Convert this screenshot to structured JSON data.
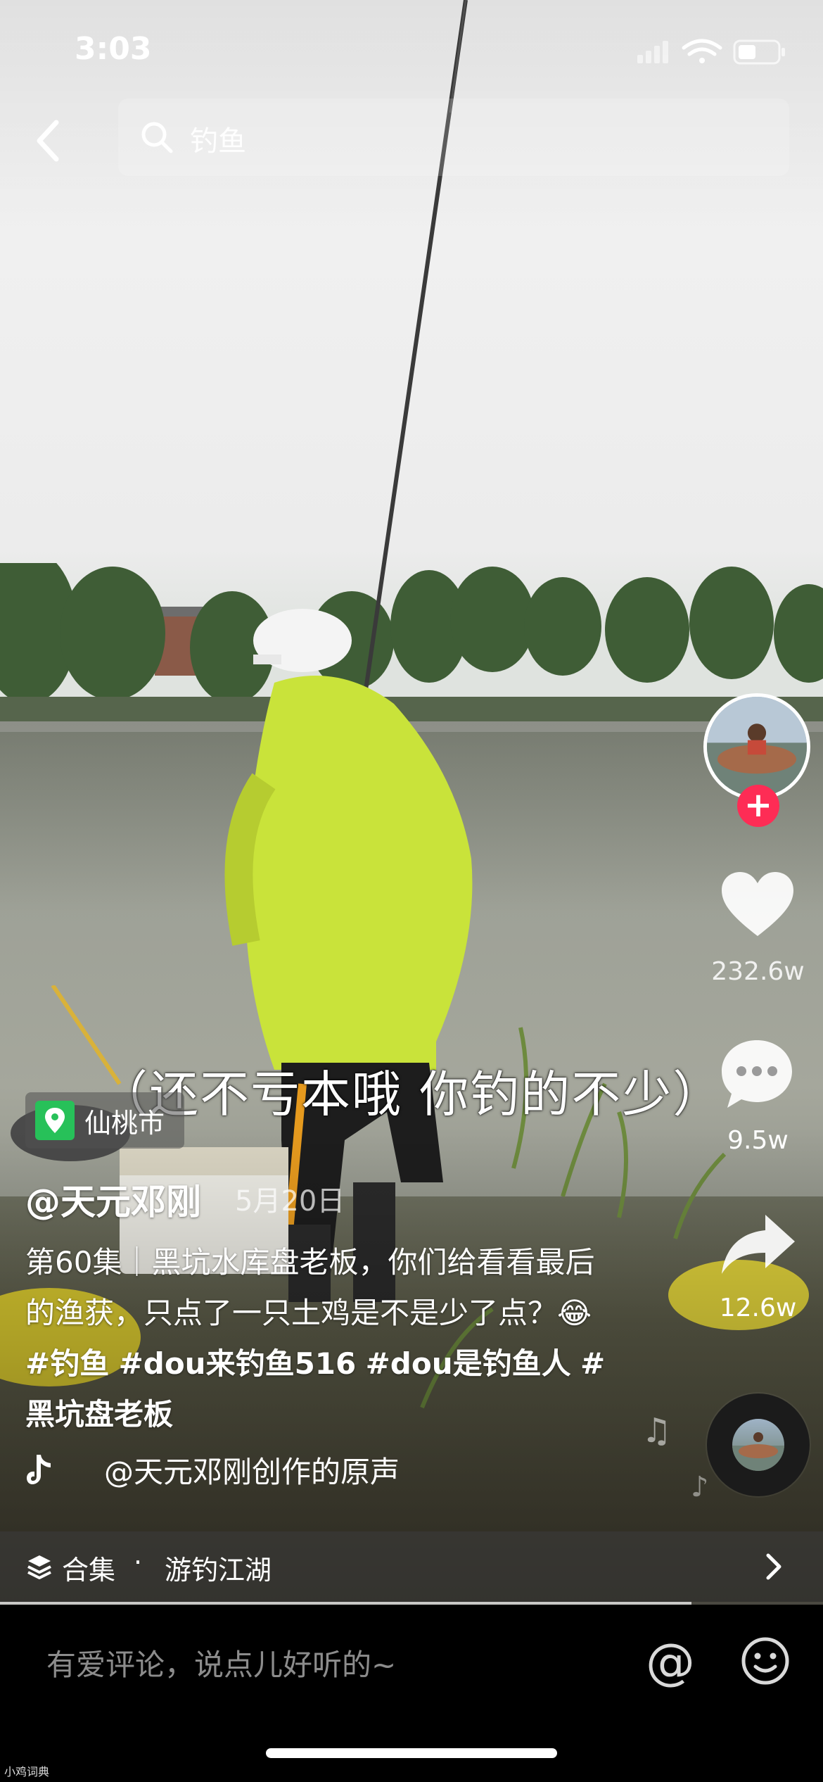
{
  "status_bar": {
    "time": "3:03"
  },
  "search": {
    "query": "钓鱼"
  },
  "video": {
    "subtitle": "（还不亏本哦 你钓的不少）",
    "location": "仙桃市",
    "author": "@天元邓刚",
    "date": "5月20日",
    "description_text": "第60集｜黑坑水库盘老板，你们给看看最后的渔获，只点了一只土鸡是不是少了点？😂",
    "hashtags": [
      "#钓鱼",
      "#dou来钓鱼516",
      "#dou是钓鱼人",
      "#黑坑盘老板"
    ],
    "music": "@天元邓刚创作的原声",
    "progress": 0.84
  },
  "actions": {
    "likes": "232.6w",
    "comments": "9.5w",
    "shares": "12.6w",
    "follow_symbol": "+"
  },
  "collection": {
    "label": "合集",
    "separator": "·",
    "name": "游钓江湖"
  },
  "comment_bar": {
    "placeholder": "有爱评论，说点儿好听的~",
    "at_symbol": "@"
  },
  "watermark": "小鸡词典",
  "icons": [
    "back-icon",
    "search-icon",
    "heart-icon",
    "comment-icon",
    "share-icon",
    "music-note-icon",
    "tiktok-icon",
    "stack-icon",
    "chevron-right-icon",
    "emoji-icon",
    "location-pin-icon",
    "signal-icon",
    "wifi-icon",
    "battery-icon"
  ],
  "colors": {
    "follow": "#fe2c55",
    "location": "#27c159"
  }
}
